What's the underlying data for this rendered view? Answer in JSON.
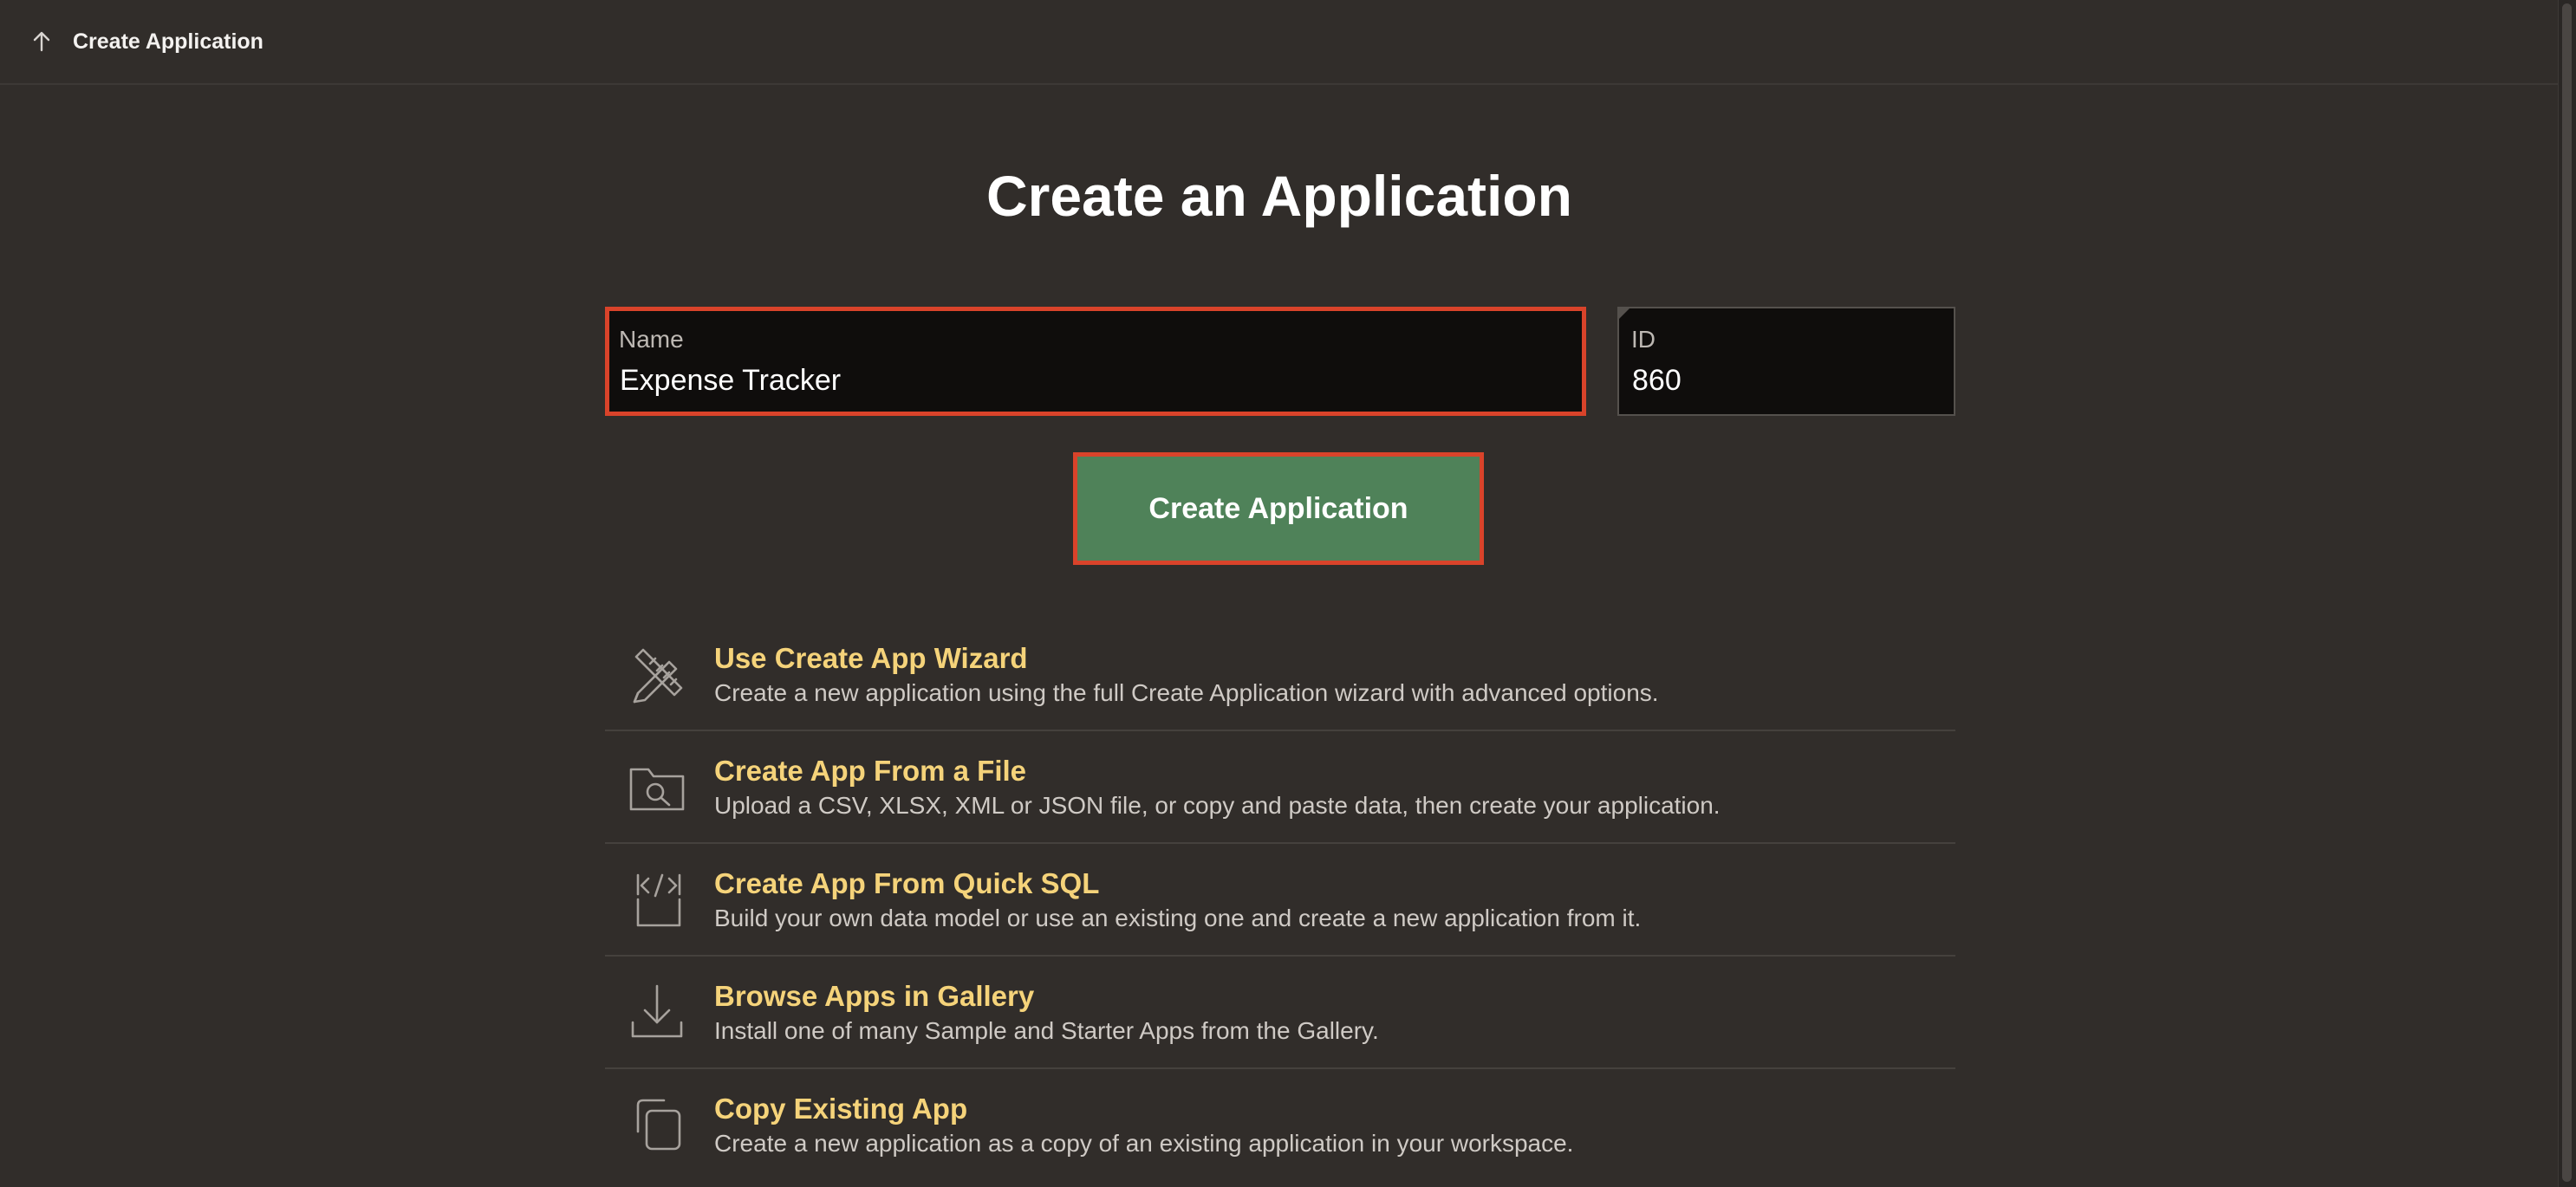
{
  "header": {
    "title": "Create Application",
    "back_icon": "arrow-up-icon"
  },
  "page": {
    "title": "Create an Application"
  },
  "form": {
    "name_label": "Name",
    "name_value": "Expense Tracker",
    "id_label": "ID",
    "id_value": "860"
  },
  "actions": {
    "create_label": "Create Application"
  },
  "options": [
    {
      "icon": "ruler-pencil-icon",
      "title": "Use Create App Wizard",
      "description": "Create a new application using the full Create Application wizard with advanced options."
    },
    {
      "icon": "folder-search-icon",
      "title": "Create App From a File",
      "description": "Upload a CSV, XLSX, XML or JSON file, or copy and paste data, then create your application."
    },
    {
      "icon": "code-file-icon",
      "title": "Create App From Quick SQL",
      "description": "Build your own data model or use an existing one and create a new application from it."
    },
    {
      "icon": "download-icon",
      "title": "Browse Apps in Gallery",
      "description": "Install one of many Sample and Starter Apps from the Gallery."
    },
    {
      "icon": "copy-icon",
      "title": "Copy Existing App",
      "description": "Create a new application as a copy of an existing application in your workspace."
    }
  ],
  "colors": {
    "background": "#312d2a",
    "accent_title": "#f5d37a",
    "primary_button": "#4f8259",
    "focus_border": "#d9432a"
  }
}
